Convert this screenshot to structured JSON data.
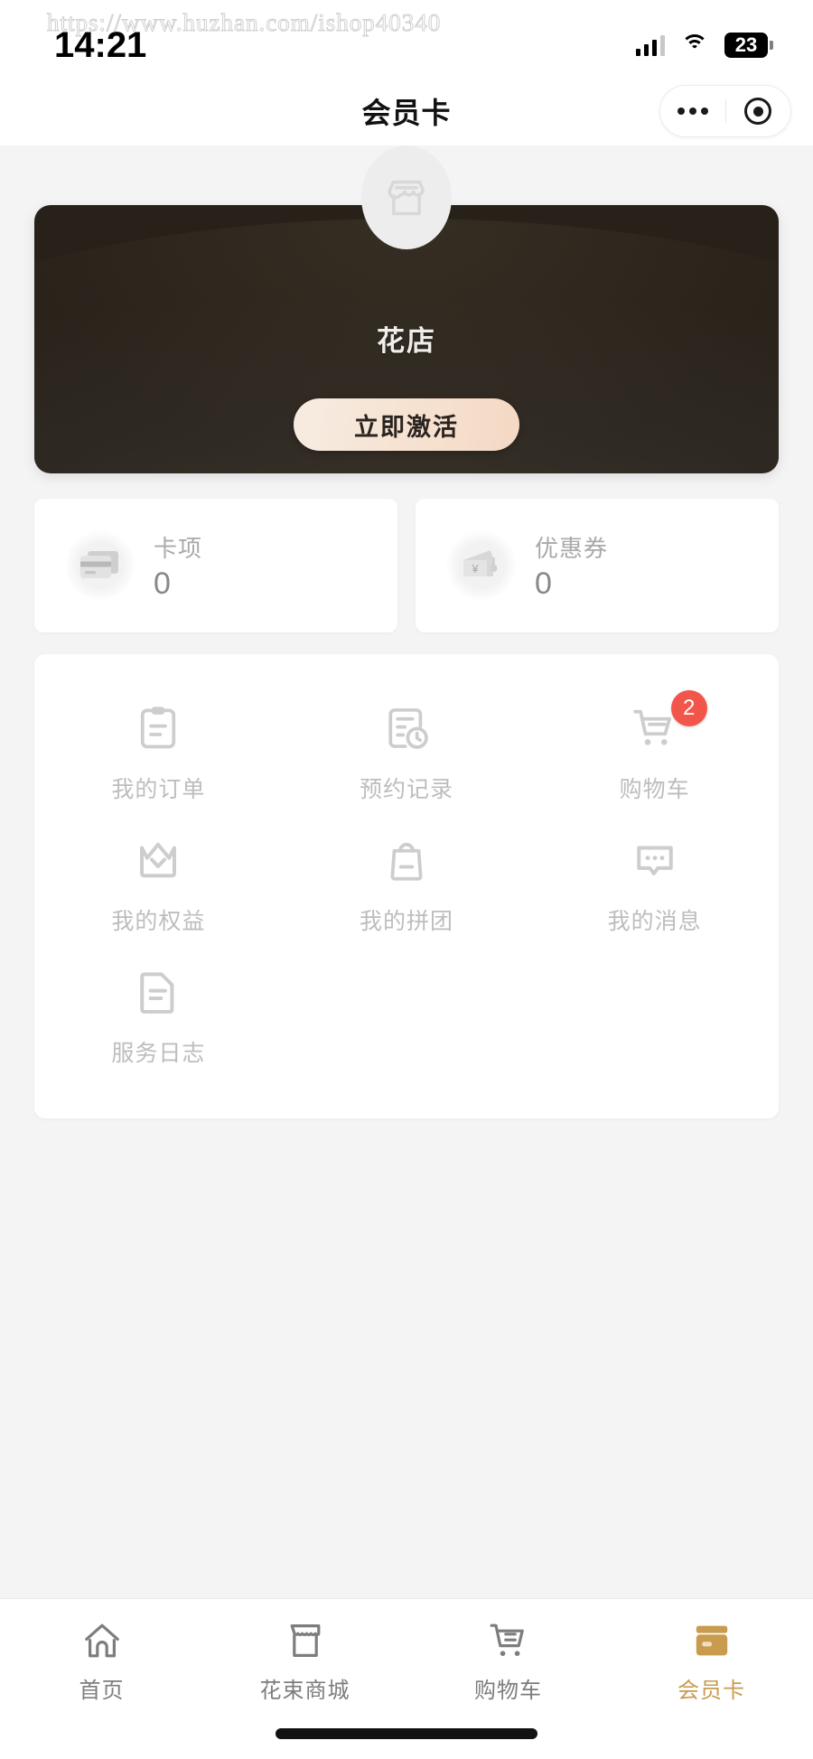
{
  "watermark": "https://www.huzhan.com/ishop40340",
  "status_bar": {
    "time": "14:21",
    "battery_level": "23",
    "signal_icon": "signal-bars-icon",
    "wifi_icon": "wifi-icon",
    "battery_icon": "battery-icon"
  },
  "nav": {
    "title": "会员卡",
    "more_icon": "more-dots-icon",
    "close_icon": "target-circle-icon"
  },
  "hero": {
    "shop_icon": "storefront-icon",
    "shop_name": "花店",
    "activate_label": "立即激活",
    "card_bg_color": "#2b2520",
    "activate_bg_color": "#f6e3d2"
  },
  "stats": [
    {
      "icon": "credit-card-icon",
      "label": "卡项",
      "value": "0"
    },
    {
      "icon": "coupon-yen-icon",
      "label": "优惠券",
      "value": "0"
    }
  ],
  "menu": {
    "rows": [
      [
        {
          "icon": "clipboard-icon",
          "label": "我的订单",
          "badge": ""
        },
        {
          "icon": "document-clock-icon",
          "label": "预约记录",
          "badge": ""
        },
        {
          "icon": "shopping-cart-icon",
          "label": "购物车",
          "badge": "2"
        }
      ],
      [
        {
          "icon": "crown-icon",
          "label": "我的权益",
          "badge": ""
        },
        {
          "icon": "shopping-bag-icon",
          "label": "我的拼团",
          "badge": ""
        },
        {
          "icon": "message-bubble-icon",
          "label": "我的消息",
          "badge": ""
        }
      ],
      [
        {
          "icon": "file-text-icon",
          "label": "服务日志",
          "badge": ""
        }
      ]
    ],
    "badge_color": "#f2554a"
  },
  "tabbar": {
    "active_color": "#c99b4f",
    "inactive_color": "#7d7d7d",
    "items": [
      {
        "icon": "home-icon",
        "label": "首页",
        "active": false
      },
      {
        "icon": "storefront-icon",
        "label": "花束商城",
        "active": false
      },
      {
        "icon": "cart-icon",
        "label": "购物车",
        "active": false
      },
      {
        "icon": "membership-card-icon",
        "label": "会员卡",
        "active": true
      }
    ]
  }
}
